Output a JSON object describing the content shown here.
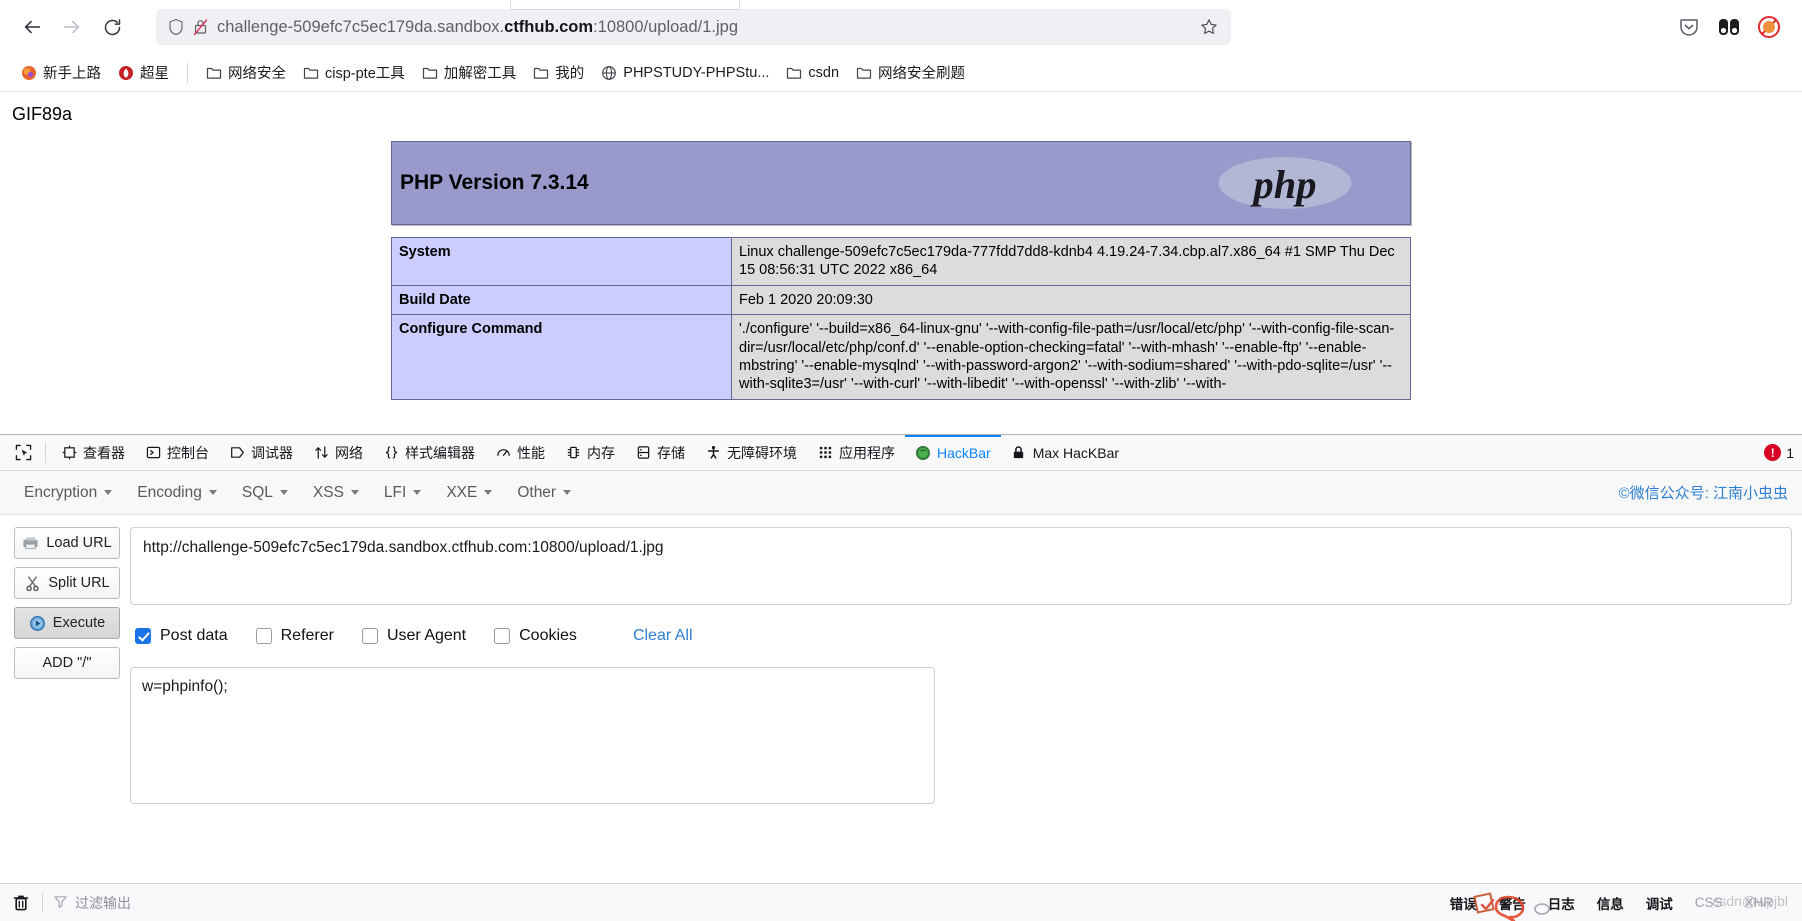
{
  "browser": {
    "nav": {
      "back_label": "←",
      "forward_label": "→",
      "reload_label": "⟳"
    },
    "url": {
      "prefix": "challenge-509efc7c5ec179da.sandbox.",
      "host_strong": "ctfhub.com",
      "suffix": ":10800/upload/1.jpg",
      "full": "challenge-509efc7c5ec179da.sandbox.ctfhub.com:10800/upload/1.jpg"
    },
    "icons": {
      "shield": "shield-icon",
      "lock_crossed": "lock-crossed-icon",
      "bookmark_star": "star-icon",
      "pocket": "pocket-icon",
      "extension": "extension-icon",
      "blocked": "blocked-icon"
    },
    "bookmarks": [
      {
        "label": "新手上路",
        "icon": "firefox-dot-icon",
        "color": "#e8632a"
      },
      {
        "label": "超星",
        "icon": "red-dot-icon",
        "color": "#c42127"
      },
      {
        "label": "网络安全",
        "icon": "folder-icon",
        "color": ""
      },
      {
        "label": "cisp-pte工具",
        "icon": "folder-icon",
        "color": ""
      },
      {
        "label": "加解密工具",
        "icon": "folder-icon",
        "color": ""
      },
      {
        "label": "我的",
        "icon": "folder-icon",
        "color": ""
      },
      {
        "label": "PHPSTUDY-PHPStu...",
        "icon": "globe-icon",
        "color": ""
      },
      {
        "label": "csdn",
        "icon": "folder-icon",
        "color": ""
      },
      {
        "label": "网络安全刷题",
        "icon": "folder-icon",
        "color": ""
      }
    ]
  },
  "page": {
    "gif_magic": "GIF89a",
    "php": {
      "version_title": "PHP Version 7.3.14",
      "logo_text": "php",
      "rows": [
        {
          "key": "System",
          "value": "Linux challenge-509efc7c5ec179da-777fdd7dd8-kdnb4 4.19.24-7.34.cbp.al7.x86_64 #1 SMP Thu Dec 15 08:56:31 UTC 2022 x86_64"
        },
        {
          "key": "Build Date",
          "value": "Feb 1 2020 20:09:30"
        },
        {
          "key": "Configure Command",
          "value": "'./configure'  '--build=x86_64-linux-gnu' '--with-config-file-path=/usr/local/etc/php' '--with-config-file-scan-dir=/usr/local/etc/php/conf.d' '--enable-option-checking=fatal' '--with-mhash' '--enable-ftp' '--enable-mbstring' '--enable-mysqlnd' '--with-password-argon2' '--with-sodium=shared' '--with-pdo-sqlite=/usr' '--with-sqlite3=/usr' '--with-curl' '--with-libedit' '--with-openssl' '--with-zlib' '--with-"
        }
      ]
    }
  },
  "devtools": {
    "picker_icon": "element-picker-icon",
    "tabs": [
      {
        "label": "查看器",
        "icon": "inspector-icon",
        "active": false
      },
      {
        "label": "控制台",
        "icon": "console-icon",
        "active": false
      },
      {
        "label": "调试器",
        "icon": "debugger-icon",
        "active": false
      },
      {
        "label": "网络",
        "icon": "network-icon",
        "active": false
      },
      {
        "label": "样式编辑器",
        "icon": "style-editor-icon",
        "active": false
      },
      {
        "label": "性能",
        "icon": "performance-icon",
        "active": false
      },
      {
        "label": "内存",
        "icon": "memory-icon",
        "active": false
      },
      {
        "label": "存储",
        "icon": "storage-icon",
        "active": false
      },
      {
        "label": "无障碍环境",
        "icon": "accessibility-icon",
        "active": false
      },
      {
        "label": "应用程序",
        "icon": "application-icon",
        "active": false
      },
      {
        "label": "HackBar",
        "icon": "hackbar-icon",
        "active": true
      },
      {
        "label": "Max HacKBar",
        "icon": "lock-icon",
        "active": false
      }
    ],
    "error_count": "1",
    "accent_color": "#0a84ff",
    "error_color": "#d70022"
  },
  "hackbar": {
    "menus": [
      {
        "label": "Encryption"
      },
      {
        "label": "Encoding"
      },
      {
        "label": "SQL"
      },
      {
        "label": "XSS"
      },
      {
        "label": "LFI"
      },
      {
        "label": "XXE"
      },
      {
        "label": "Other"
      }
    ],
    "credit": "©微信公众号: 江南小虫虫",
    "buttons": [
      {
        "label": "Load URL",
        "icon": "load-url-icon",
        "pressed": false
      },
      {
        "label": "Split URL",
        "icon": "scissors-icon",
        "pressed": false
      },
      {
        "label": "Execute",
        "icon": "play-icon",
        "pressed": true
      },
      {
        "label": "ADD \"/\"",
        "icon": "",
        "pressed": false
      }
    ],
    "url_value": "http://challenge-509efc7c5ec179da.sandbox.ctfhub.com:10800/upload/1.jpg",
    "url_placeholder": "",
    "options": [
      {
        "label": "Post data",
        "checked": true
      },
      {
        "label": "Referer",
        "checked": false
      },
      {
        "label": "User Agent",
        "checked": false
      },
      {
        "label": "Cookies",
        "checked": false
      }
    ],
    "clear_all_label": "Clear All",
    "postdata_value": "w=phpinfo();",
    "postdata_placeholder": ""
  },
  "console": {
    "trash_icon": "trash-icon",
    "filter_icon": "filter-icon",
    "filter_placeholder": "过滤输出",
    "filters": [
      {
        "label": "错误",
        "muted": false
      },
      {
        "label": "警告",
        "muted": false
      },
      {
        "label": "日志",
        "muted": false
      },
      {
        "label": "信息",
        "muted": false
      },
      {
        "label": "调试",
        "muted": false
      },
      {
        "label": "CSS",
        "muted": true
      },
      {
        "label": "XHR",
        "muted": true
      }
    ],
    "watermark": "csdn@wpjbl"
  }
}
